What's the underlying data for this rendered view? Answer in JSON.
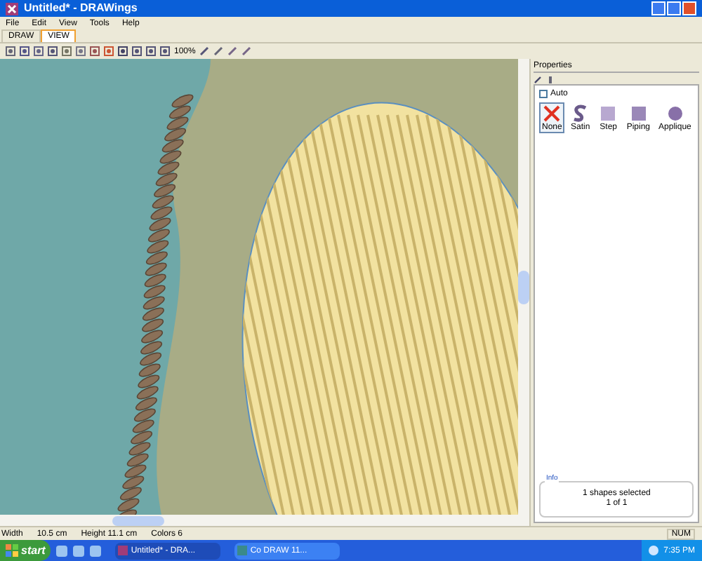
{
  "window": {
    "title": "Untitled* - DRAWings"
  },
  "menu": [
    "File",
    "Edit",
    "View",
    "Tools",
    "Help"
  ],
  "tabs": [
    {
      "label": "DRAW",
      "selected": false
    },
    {
      "label": "VIEW",
      "selected": true
    }
  ],
  "toolbar": {
    "zoom": "100%"
  },
  "properties": {
    "title": "Properties",
    "auto": {
      "label": "Auto",
      "checked": false
    },
    "stitch_types": [
      {
        "label": "None",
        "selected": true
      },
      {
        "label": "Satin",
        "selected": false
      },
      {
        "label": "Step",
        "selected": false
      },
      {
        "label": "Piping",
        "selected": false
      },
      {
        "label": "Applique",
        "selected": false
      }
    ],
    "info": {
      "title": "Info",
      "lines": [
        "1 shapes selected",
        "1 of 1"
      ]
    }
  },
  "status_bar": [
    "Width",
    "10.5 cm",
    "Height 11.1 cm",
    "Colors 6",
    "NUM"
  ],
  "taskbar": {
    "start": "start",
    "tasks": [
      "Untitled* - DRA...",
      "Co DRAW 11..."
    ],
    "time": "7:35 PM"
  }
}
